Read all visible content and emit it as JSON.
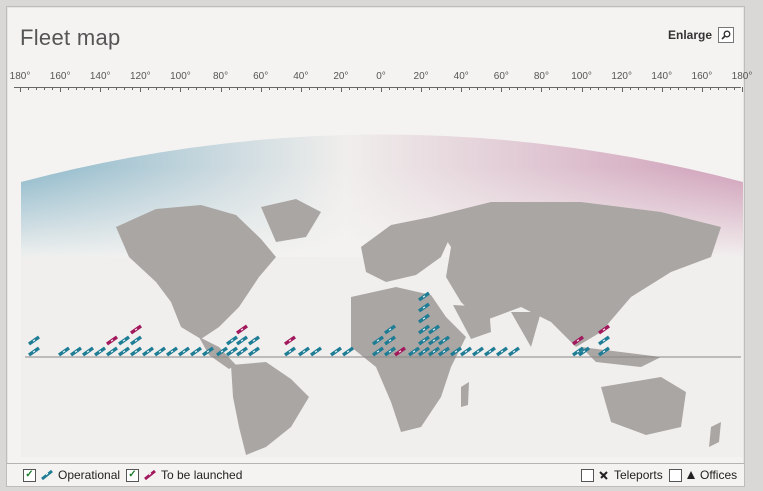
{
  "page": {
    "title": "Fleet map",
    "enlarge_label": "Enlarge"
  },
  "ruler": {
    "labels": [
      "180°",
      "160°",
      "140°",
      "120°",
      "100°",
      "80°",
      "60°",
      "40°",
      "20°",
      "0°",
      "20°",
      "40°",
      "60°",
      "80°",
      "100°",
      "120°",
      "140°",
      "160°",
      "180°"
    ]
  },
  "legend": {
    "operational": {
      "label": "Operational",
      "checked": true
    },
    "to_be_launched": {
      "label": "To be launched",
      "checked": true
    },
    "teleports": {
      "label": "Teleports",
      "checked": false
    },
    "offices": {
      "label": "Offices",
      "checked": false
    }
  },
  "colors": {
    "operational": "#1e7d95",
    "to_be_launched": "#a1185c",
    "land": "#a9a5a3",
    "ocean": "#f0eeec",
    "sky_left": "#8bb6c9",
    "sky_right": "#c99ab3"
  },
  "icons": {
    "enlarge": "magnifier-icon",
    "teleport": "satellite-dish-icon",
    "office": "triangle-icon"
  }
}
